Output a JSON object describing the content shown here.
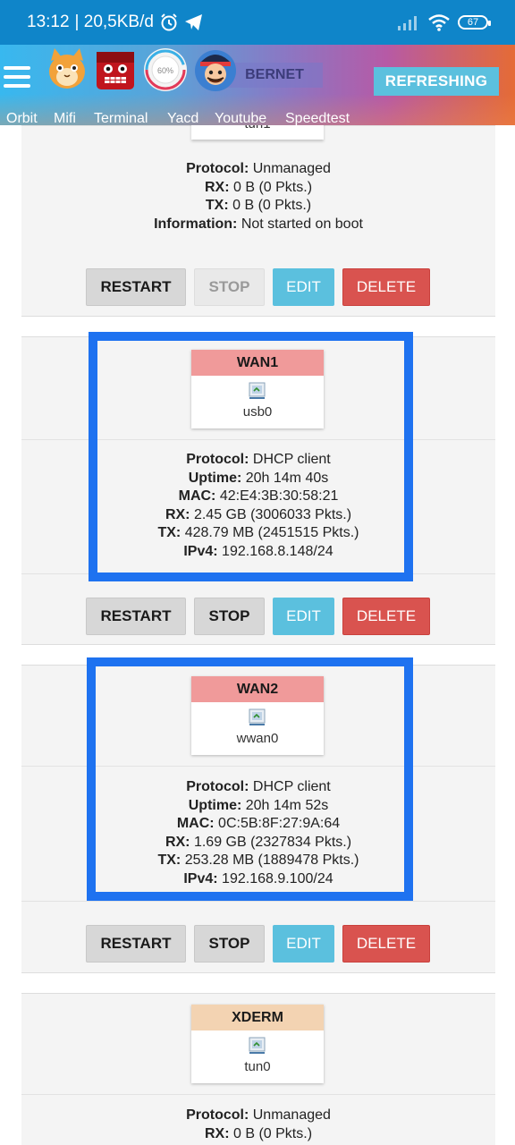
{
  "status_bar": {
    "time": "13:12",
    "net_speed": "| 20,5KB/d",
    "battery": "67"
  },
  "app_bar": {
    "refresh_label": "REFRESHING",
    "hidden_card_title": "BERNET",
    "apps": [
      {
        "label": "Orbit"
      },
      {
        "label": "Mifi"
      },
      {
        "label": "Terminal"
      },
      {
        "label": "Yacd"
      },
      {
        "label": "Youtube"
      },
      {
        "label": "Speedtest"
      }
    ]
  },
  "interfaces": [
    {
      "name": "BERNET",
      "device": "tun1",
      "info": [
        {
          "k": "Protocol:",
          "v": " Unmanaged"
        },
        {
          "k": "RX:",
          "v": " 0 B (0 Pkts.)"
        },
        {
          "k": "TX:",
          "v": " 0 B (0 Pkts.)"
        },
        {
          "k": "Information:",
          "v": " Not started on boot"
        }
      ],
      "buttons": {
        "restart": "RESTART",
        "stop": "STOP",
        "edit": "EDIT",
        "delete": "DELETE"
      }
    },
    {
      "name": "WAN1",
      "device": "usb0",
      "color": "#f09a9a",
      "info": [
        {
          "k": "Protocol:",
          "v": " DHCP client"
        },
        {
          "k": "Uptime:",
          "v": " 20h 14m 40s"
        },
        {
          "k": "MAC:",
          "v": " 42:E4:3B:30:58:21"
        },
        {
          "k": "RX:",
          "v": " 2.45 GB (3006033 Pkts.)"
        },
        {
          "k": "TX:",
          "v": " 428.79 MB (2451515 Pkts.)"
        },
        {
          "k": "IPv4:",
          "v": " 192.168.8.148/24"
        }
      ],
      "buttons": {
        "restart": "RESTART",
        "stop": "STOP",
        "edit": "EDIT",
        "delete": "DELETE"
      }
    },
    {
      "name": "WAN2",
      "device": "wwan0",
      "color": "#f09a9a",
      "info": [
        {
          "k": "Protocol:",
          "v": " DHCP client"
        },
        {
          "k": "Uptime:",
          "v": " 20h 14m 52s"
        },
        {
          "k": "MAC:",
          "v": " 0C:5B:8F:27:9A:64"
        },
        {
          "k": "RX:",
          "v": " 1.69 GB (2327834 Pkts.)"
        },
        {
          "k": "TX:",
          "v": " 253.28 MB (1889478 Pkts.)"
        },
        {
          "k": "IPv4:",
          "v": " 192.168.9.100/24"
        }
      ],
      "buttons": {
        "restart": "RESTART",
        "stop": "STOP",
        "edit": "EDIT",
        "delete": "DELETE"
      }
    },
    {
      "name": "XDERM",
      "device": "tun0",
      "color": "#f3d3b2",
      "info": [
        {
          "k": "Protocol:",
          "v": " Unmanaged"
        },
        {
          "k": "RX:",
          "v": " 0 B (0 Pkts.)"
        }
      ]
    }
  ]
}
